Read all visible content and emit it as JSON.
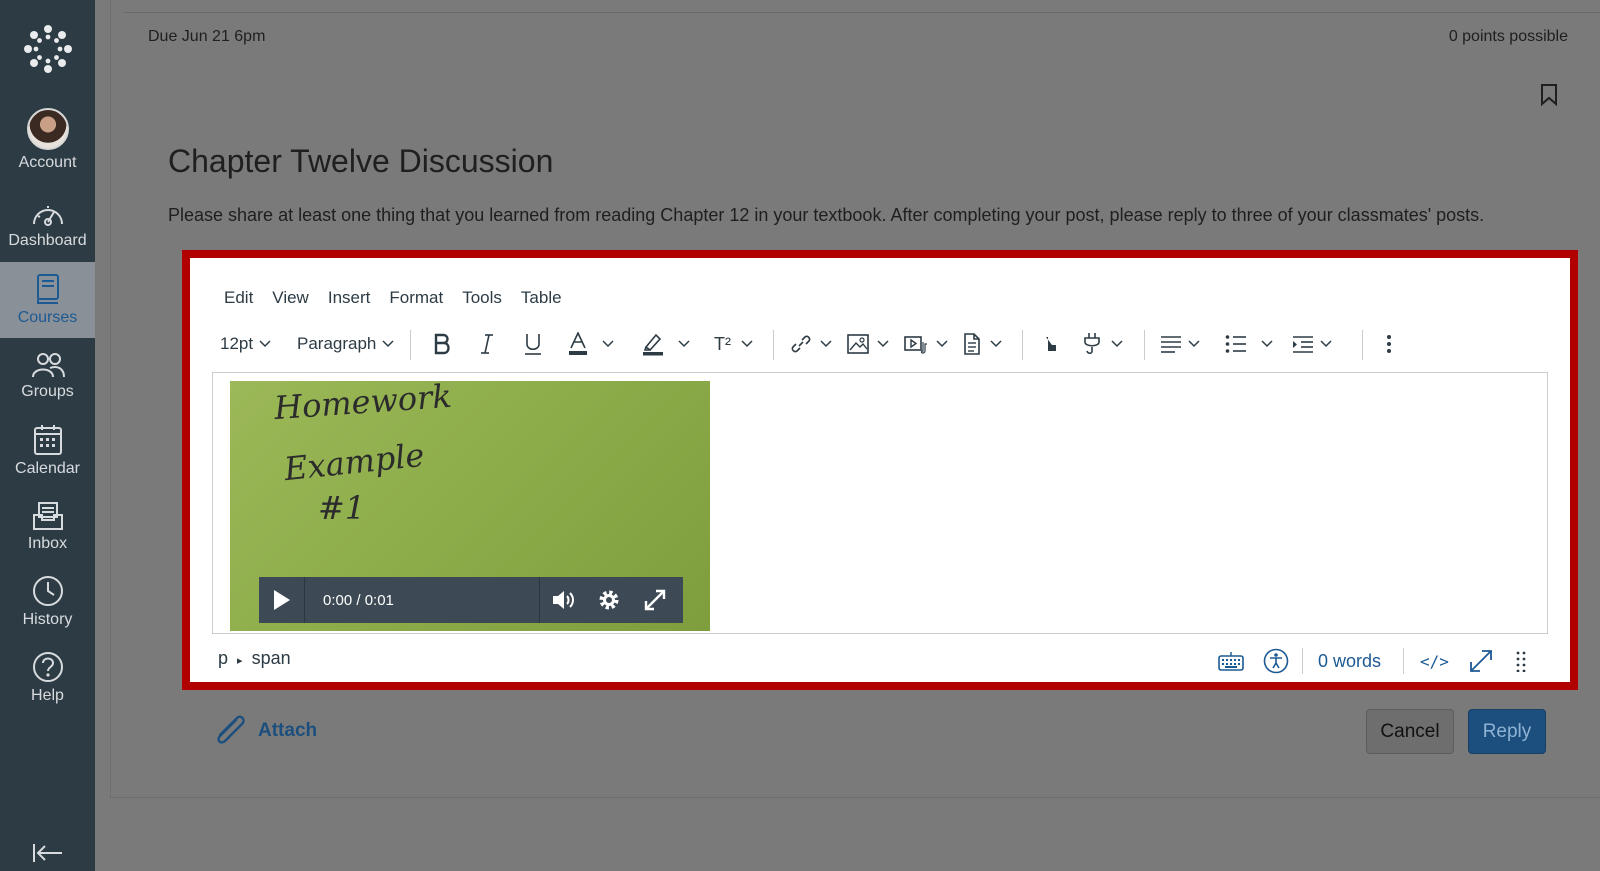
{
  "nav": {
    "items": [
      {
        "label": "Account",
        "icon": "avatar"
      },
      {
        "label": "Dashboard",
        "icon": "dashboard-icon"
      },
      {
        "label": "Courses",
        "icon": "courses-icon",
        "active": true
      },
      {
        "label": "Groups",
        "icon": "groups-icon"
      },
      {
        "label": "Calendar",
        "icon": "calendar-icon"
      },
      {
        "label": "Inbox",
        "icon": "inbox-icon"
      },
      {
        "label": "History",
        "icon": "history-icon"
      },
      {
        "label": "Help",
        "icon": "help-icon"
      }
    ],
    "active_color": "#1c5a93"
  },
  "assignment": {
    "due": "Due Jun 21 6pm",
    "points": "0 points possible",
    "title": "Chapter Twelve Discussion",
    "prompt": "Please share at least one thing that you learned from reading Chapter 12 in your textbook. After completing your post, please reply to three of your classmates' posts."
  },
  "editor": {
    "menu": [
      "Edit",
      "View",
      "Insert",
      "Format",
      "Tools",
      "Table"
    ],
    "font_size": "12pt",
    "block_format": "Paragraph",
    "superscript_label": "T²",
    "video": {
      "handwriting": [
        "Homework",
        "Example",
        "#1"
      ],
      "time": "0:00 / 0:01"
    },
    "status": {
      "path": [
        "p",
        "span"
      ],
      "word_count": "0 words",
      "html_toggle": "</>"
    },
    "highlight_color": "#b00000"
  },
  "actions": {
    "attach": "Attach",
    "cancel": "Cancel",
    "reply": "Reply"
  }
}
